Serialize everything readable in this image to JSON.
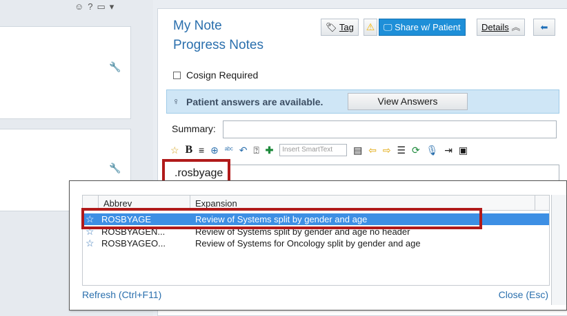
{
  "left": {
    "icons": [
      "smiley-icon",
      "help-icon",
      "layout-icon"
    ],
    "wrench_glyph": "🔧"
  },
  "note": {
    "title": "My Note",
    "subtitle": "Progress Notes",
    "buttons": {
      "tag": "Tag",
      "share": "Share w/ Patient",
      "details": "Details",
      "details_chevron": "≈",
      "back": "⬅"
    },
    "cosign_label": "Cosign Required",
    "patient_answers": "Patient answers are available.",
    "view_answers": "View Answers",
    "summary_label": "Summary:",
    "smarttext_placeholder": "Insert SmartText",
    "editor_text": ".rosbyage"
  },
  "popup": {
    "columns": [
      "Abbrev",
      "Expansion"
    ],
    "rows": [
      {
        "abbrev": "ROSBYAGE",
        "expansion": "Review of Systems split by gender and age",
        "selected": true
      },
      {
        "abbrev": "ROSBYAGEN...",
        "expansion": "Review of Systems split by gender and age no header",
        "selected": false
      },
      {
        "abbrev": "ROSBYAGEO...",
        "expansion": "Review of Systems for Oncology split by gender and age",
        "selected": false
      }
    ],
    "refresh": "Refresh (Ctrl+F11)",
    "close": "Close (Esc)"
  },
  "colors": {
    "accent": "#2a6fad",
    "share_button": "#1e8fd8",
    "selection": "#3d8fe4",
    "highlight_box": "#b01a1a",
    "answers_bar": "#cfe6f6"
  }
}
